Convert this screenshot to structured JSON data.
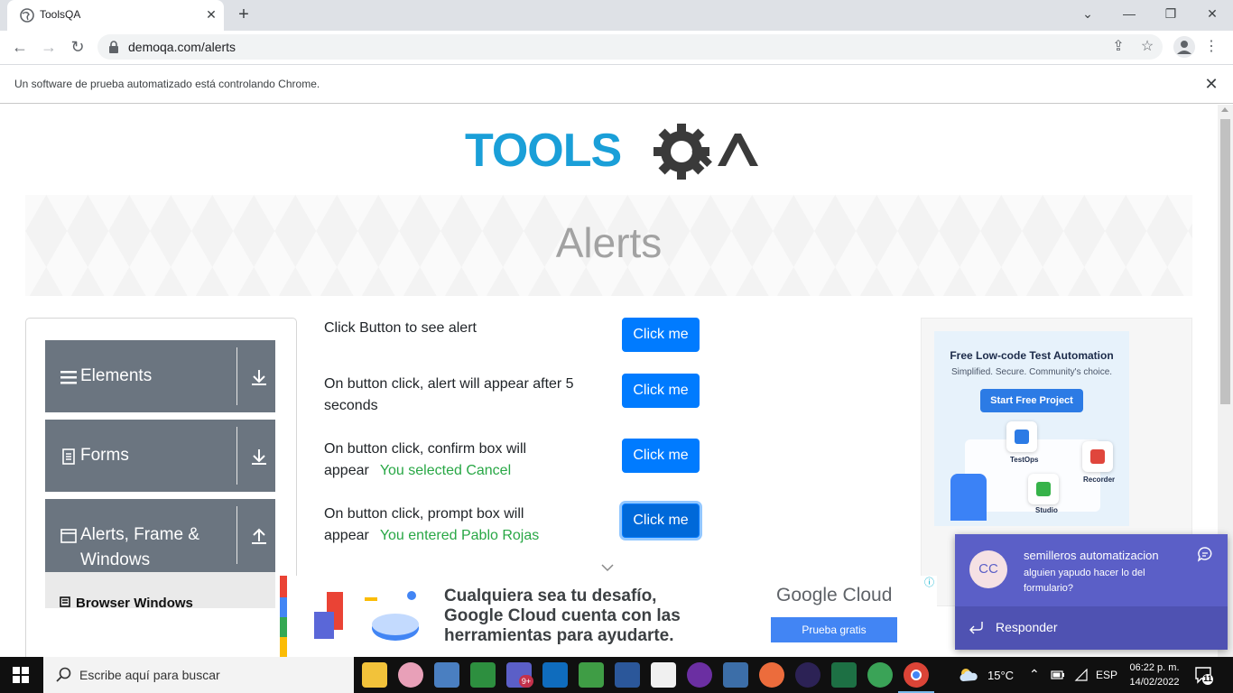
{
  "browser": {
    "tab_title": "ToolsQA",
    "url": "demoqa.com/alerts",
    "infobar_text": "Un software de prueba automatizado está controlando Chrome."
  },
  "page": {
    "title": "Alerts",
    "logo_text": "TOOLSQA"
  },
  "sidebar": {
    "groups": [
      {
        "label": "Elements",
        "icon": "hamburger-icon",
        "expanded": false
      },
      {
        "label": "Forms",
        "icon": "document-icon",
        "expanded": false
      },
      {
        "label": "Alerts, Frame & Windows",
        "label_line1": "Alerts, Frame &",
        "label_line2": "Windows",
        "icon": "window-icon",
        "expanded": true
      }
    ],
    "submenu_items": [
      {
        "label": "Browser Windows"
      }
    ]
  },
  "alerts": {
    "rows": [
      {
        "text_line1": "Click Button to see alert",
        "text_line2": "",
        "result": "",
        "button": "Click me"
      },
      {
        "text_line1": "On button click, alert will appear after 5",
        "text_line2": "seconds",
        "result": "",
        "button": "Click me"
      },
      {
        "text_line1": "On button click, confirm box will",
        "text_line2": "appear",
        "result": "You selected Cancel",
        "button": "Click me"
      },
      {
        "text_line1": "On button click, prompt box will",
        "text_line2": "appear",
        "result": "You entered Pablo Rojas",
        "button": "Click me"
      }
    ]
  },
  "right_ad": {
    "headline": "Free Low-code Test Automation",
    "subline": "Simplified. Secure. Community's choice.",
    "cta": "Start Free Project",
    "badges": [
      "TestOps",
      "Recorder",
      "Studio"
    ]
  },
  "bottom_ad": {
    "line1": "Cualquiera sea tu desafío,",
    "line2": "Google Cloud cuenta con las",
    "line3": "herramientas para ayudarte.",
    "brand": "Google Cloud",
    "cta": "Prueba gratis"
  },
  "toast": {
    "avatar": "CC",
    "title": "semilleros automatizacion",
    "body": "alguien yapudo hacer lo del formulario?",
    "reply": "Responder"
  },
  "taskbar": {
    "search_placeholder": "Escribe aquí para buscar",
    "weather": "15°C",
    "language": "ESP",
    "time": "06:22 p. m.",
    "date": "14/02/2022",
    "notification_count": "11",
    "teams_badge": "9+"
  },
  "colors": {
    "primary_button": "#007bff",
    "sidebar_group": "#6b7580",
    "success_text": "#28a745",
    "teams_purple": "#5b5fc7",
    "toolsqa_blue": "#1a9fd8"
  }
}
